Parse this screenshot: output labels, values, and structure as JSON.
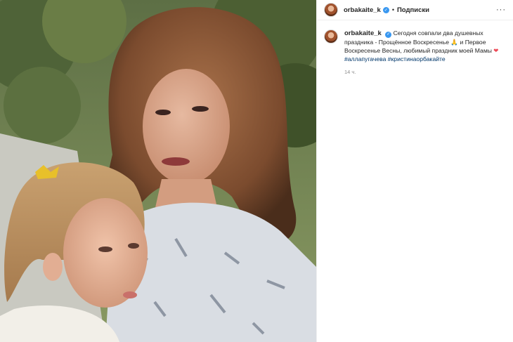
{
  "post": {
    "username": "orbakaite_k",
    "follow_label": "Подписки",
    "separator": "•",
    "more_label": "···",
    "verified_mark": "✓",
    "caption": {
      "username": "orbakaite_k",
      "text_part1": "Сегодня совпали два душевных праздника - Прощённое Воскресенье",
      "emoji_pray": "🙏",
      "text_part2": "и Первое Воскресенье Весны, любимый праздник моей Мамы",
      "emoji_heart": "❤",
      "hashtag1": "#аллапугачева",
      "hashtag2": "#кристинаорбакайте"
    },
    "time_ago": "14 ч."
  },
  "colors": {
    "link": "#00376b",
    "secondary_text": "#8e8e8e",
    "verified": "#3897f0",
    "heart": "#ed4956"
  },
  "icons": {
    "verified": "verified-badge-icon",
    "more": "more-options-icon"
  }
}
